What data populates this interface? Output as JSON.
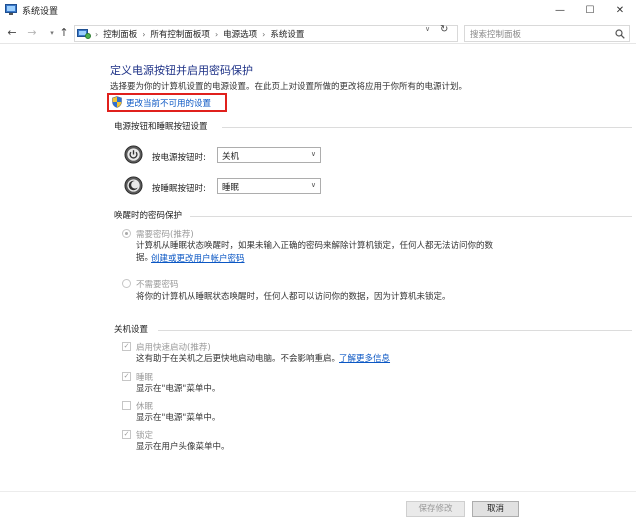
{
  "window": {
    "title": "系统设置",
    "minimize_glyph": "—",
    "maximize_glyph": "☐",
    "close_glyph": "✕"
  },
  "nav": {
    "back_glyph": "←",
    "forward_glyph": "→",
    "dropdown_glyph": "▾",
    "up_glyph": "↑",
    "breadcrumbs": [
      "控制面板",
      "所有控制面板项",
      "电源选项",
      "系统设置"
    ],
    "breadcrumb_separator": "›",
    "address_dropdown_glyph": "∨",
    "refresh_glyph": "↻",
    "search_placeholder": "搜索控制面板"
  },
  "page": {
    "heading": "定义电源按钮并启用密码保护",
    "subtext": "选择要为你的计算机设置的电源设置。在此页上对设置所做的更改将应用于你所有的电源计划。",
    "change_unavailable_link": "更改当前不可用的设置"
  },
  "buttons_section": {
    "title": "电源按钮和睡眠按钮设置",
    "power_button_label": "按电源按钮时:",
    "power_button_value": "关机",
    "sleep_button_label": "按睡眠按钮时:",
    "sleep_button_value": "睡眠",
    "select_arrow": "∨"
  },
  "wake_section": {
    "title": "唤醒时的密码保护",
    "require_password_label": "需要密码(推荐)",
    "require_password_desc_1": "计算机从睡眠状态唤醒时，如果未输入正确的密码来解除计算机锁定，任何人都无法访问你的数",
    "require_password_desc_2": "据。",
    "create_password_link": "创建或更改用户帐户密码",
    "no_password_label": "不需要密码",
    "no_password_desc": "将你的计算机从睡眠状态唤醒时，任何人都可以访问你的数据，因为计算机未锁定。"
  },
  "shutdown_section": {
    "title": "关机设置",
    "check_glyph": "✓",
    "fast_startup_label": "启用快速启动(推荐)",
    "fast_startup_desc": "这有助于在关机之后更快地启动电脑。不会影响重启。",
    "learn_more_link": "了解更多信息",
    "sleep_label": "睡眠",
    "sleep_desc": "显示在\"电源\"菜单中。",
    "hibernate_label": "休眠",
    "hibernate_desc": "显示在\"电源\"菜单中。",
    "lock_label": "锁定",
    "lock_desc": "显示在用户头像菜单中。"
  },
  "footer": {
    "save_label": "保存修改",
    "cancel_label": "取消"
  },
  "colors": {
    "heading": "#1e3287",
    "link": "#0b57c4",
    "highlight_box": "#e0201c"
  }
}
